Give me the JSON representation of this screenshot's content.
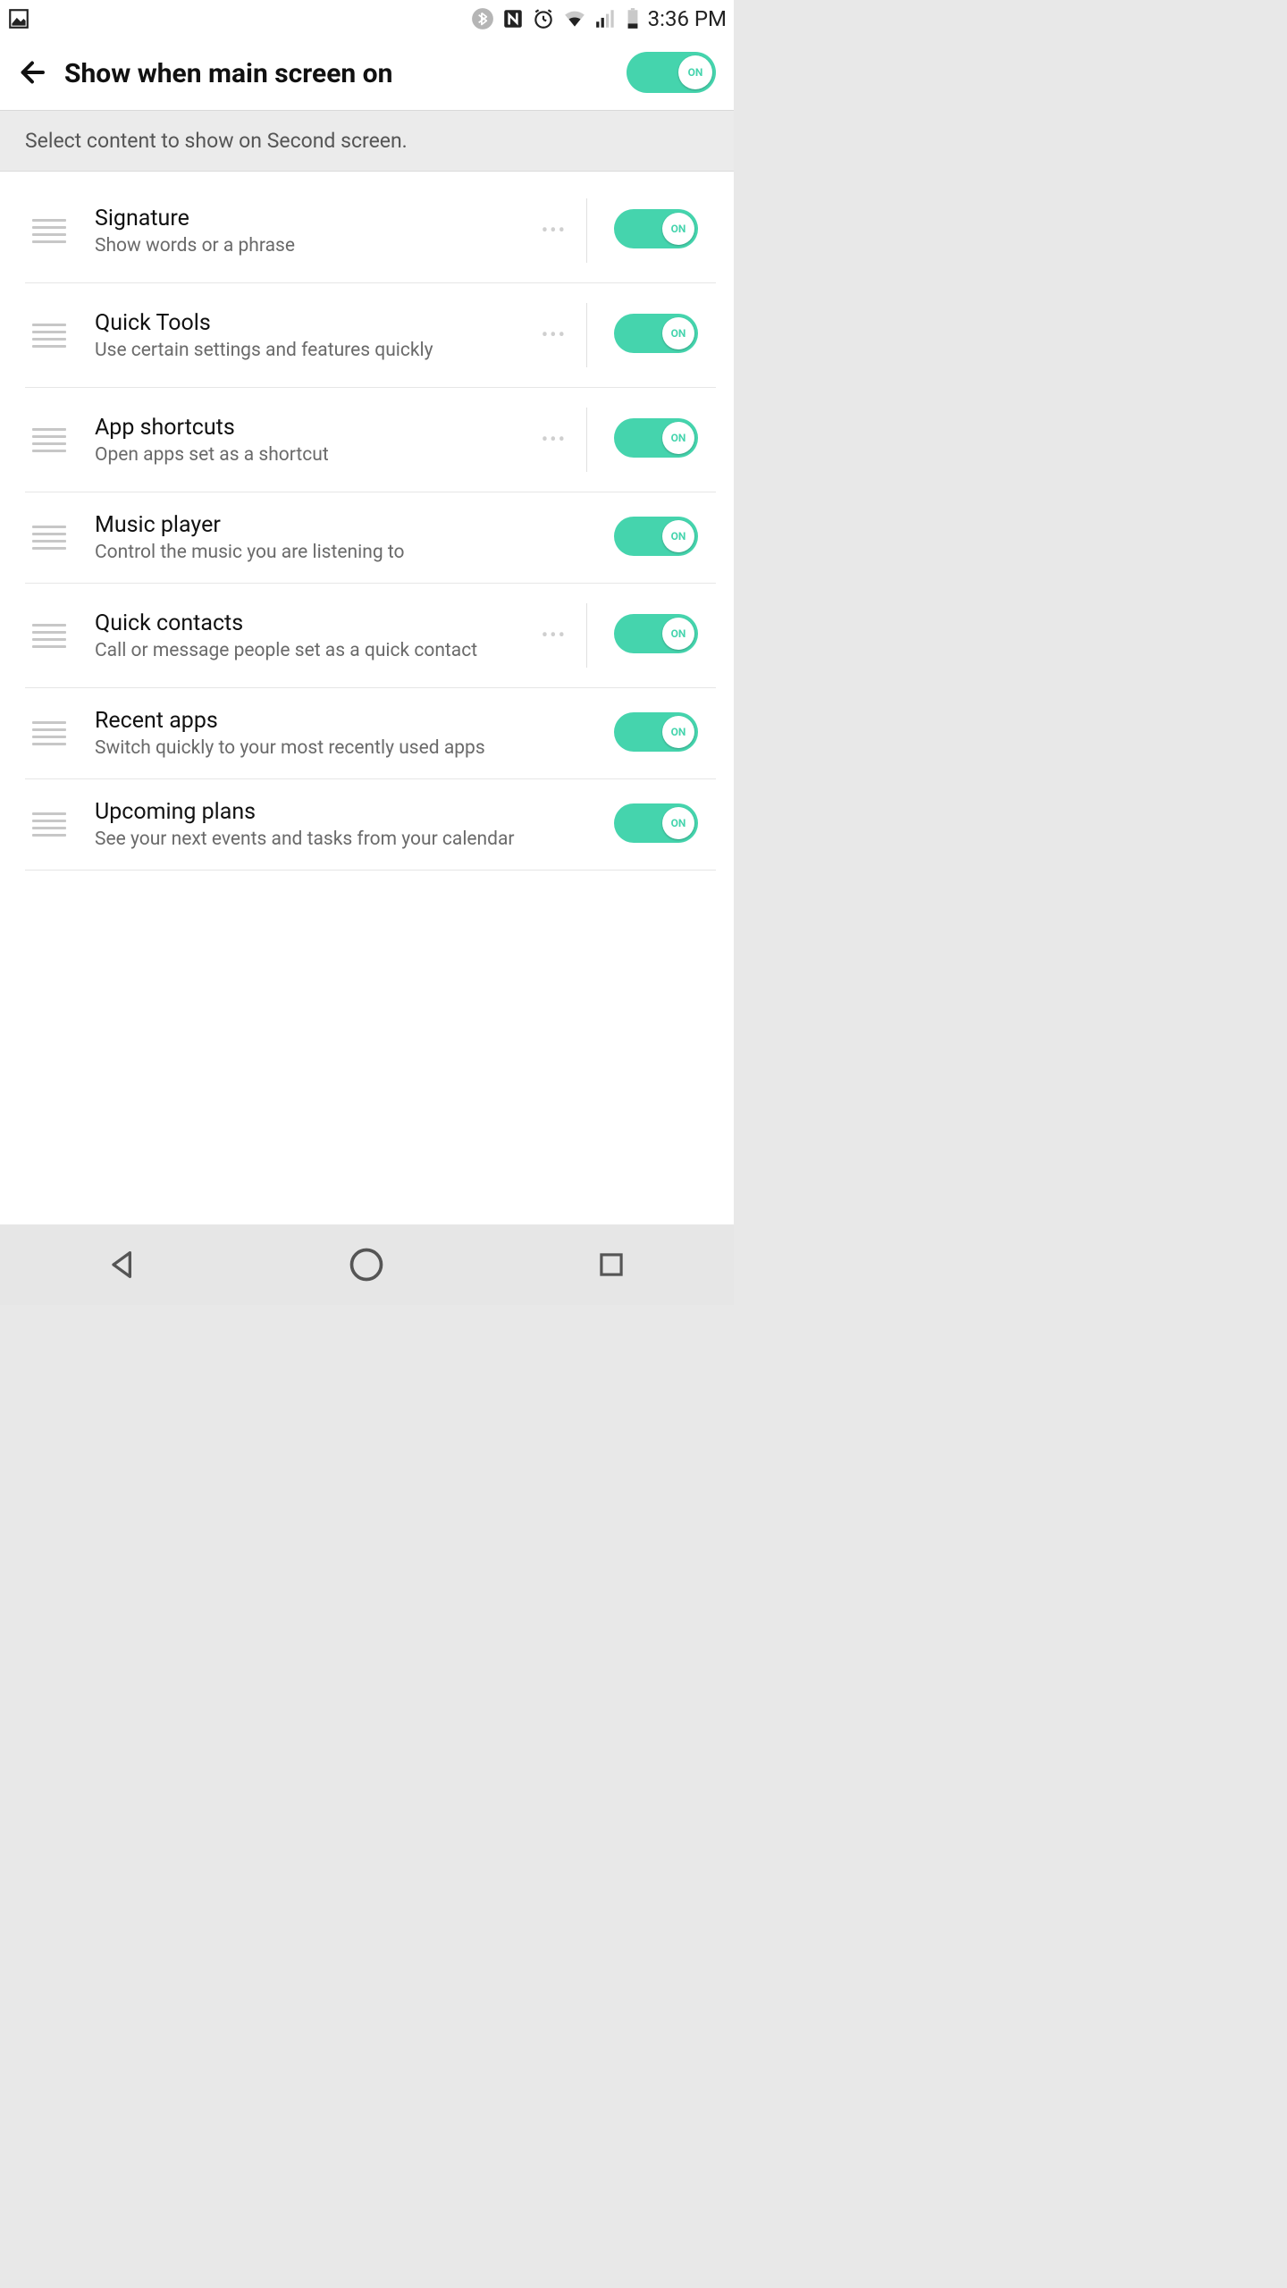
{
  "status": {
    "time": "3:36 PM"
  },
  "header": {
    "title": "Show when main screen on",
    "master_toggle": {
      "state": "ON",
      "color": "#45d4ad"
    }
  },
  "instruction": "Select content to show on Second screen.",
  "items": [
    {
      "title": "Signature",
      "subtitle": "Show words or a phrase",
      "has_more": true,
      "toggle": "ON"
    },
    {
      "title": "Quick Tools",
      "subtitle": "Use certain settings and features quickly",
      "has_more": true,
      "toggle": "ON"
    },
    {
      "title": "App shortcuts",
      "subtitle": "Open apps set as a shortcut",
      "has_more": true,
      "toggle": "ON"
    },
    {
      "title": "Music player",
      "subtitle": "Control the music you are listening to",
      "has_more": false,
      "toggle": "ON"
    },
    {
      "title": "Quick contacts",
      "subtitle": "Call or message people set as a quick contact",
      "has_more": true,
      "toggle": "ON"
    },
    {
      "title": "Recent apps",
      "subtitle": "Switch quickly to your most recently used apps",
      "has_more": false,
      "toggle": "ON"
    },
    {
      "title": "Upcoming plans",
      "subtitle": "See your next events and tasks from your calendar",
      "has_more": false,
      "toggle": "ON"
    }
  ],
  "icons": {
    "picture": "picture-icon",
    "bluetooth": "bluetooth-icon",
    "nfc": "nfc-icon",
    "alarm": "alarm-icon",
    "wifi": "wifi-icon",
    "signal": "signal-icon",
    "battery": "battery-icon",
    "back": "back-arrow-icon",
    "drag": "drag-handle-icon",
    "more": "more-dots-icon",
    "nav_back": "nav-back-icon",
    "nav_home": "nav-home-icon",
    "nav_recent": "nav-recent-icon"
  },
  "colors": {
    "accent": "#45d4ad",
    "text_primary": "#111111",
    "text_secondary": "#6a6a6a",
    "divider": "#e6e6e6",
    "instruction_bg": "#ebebeb"
  }
}
